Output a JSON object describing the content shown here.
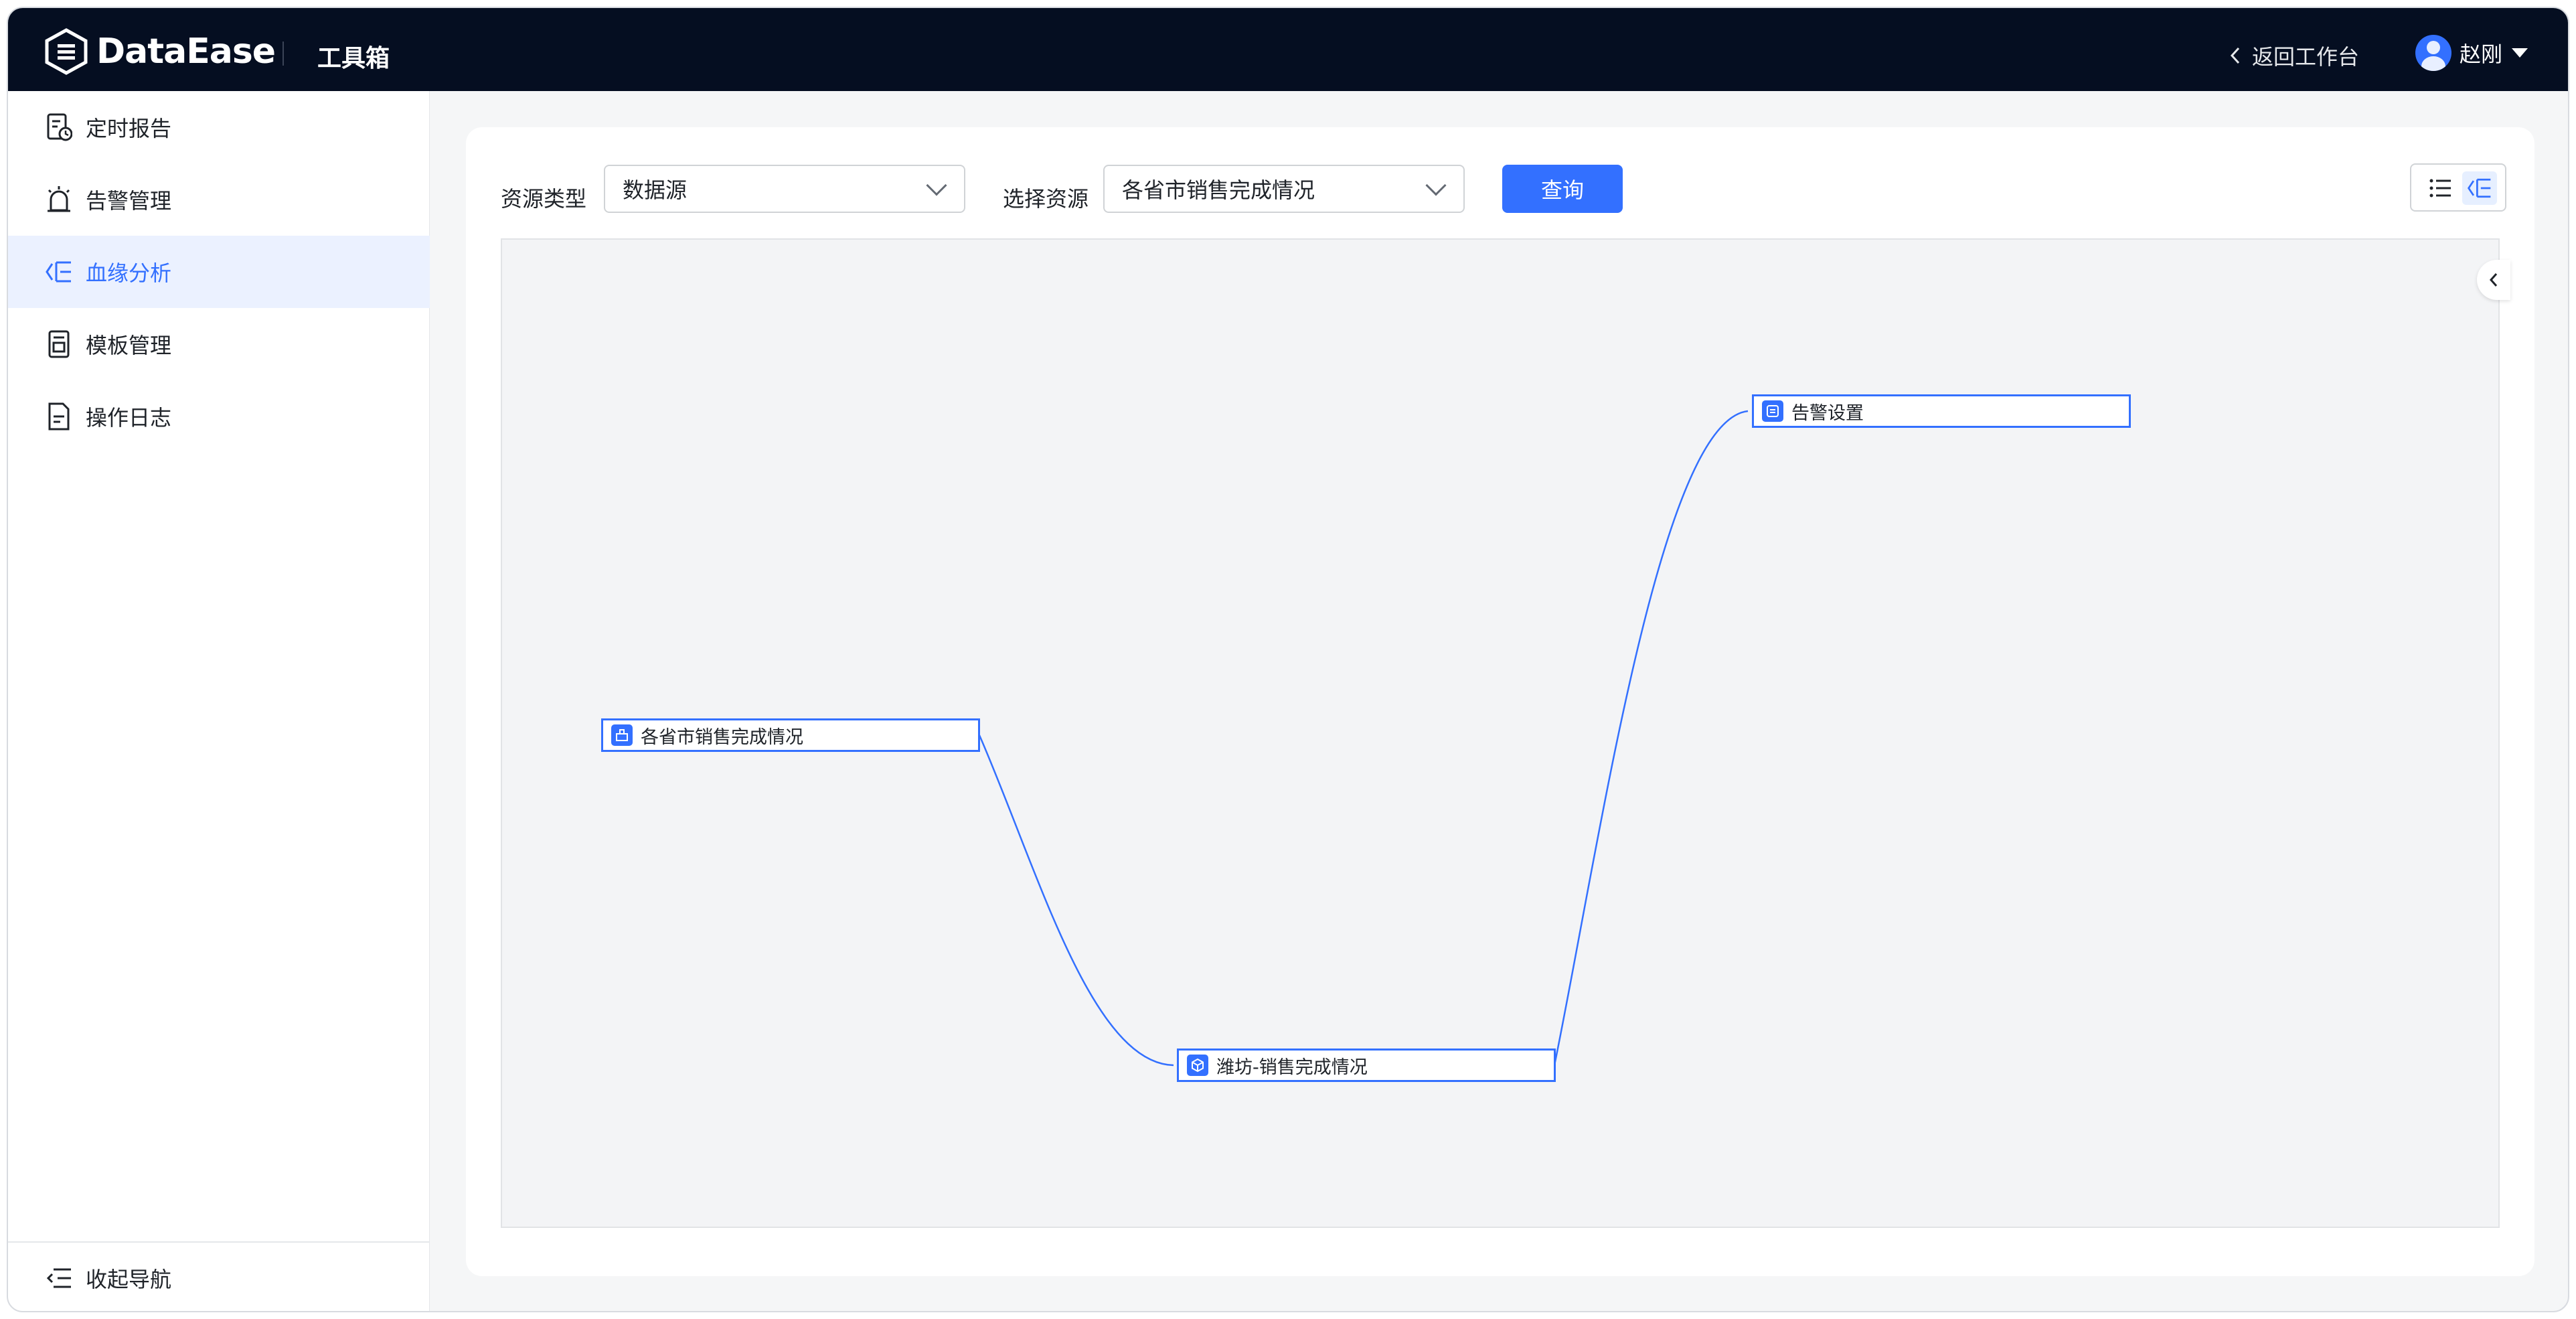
{
  "header": {
    "brand": "DataEase",
    "section_title": "工具箱",
    "back_label": "返回工作台",
    "user_name": "赵刚"
  },
  "sidebar": {
    "items": [
      {
        "label": "定时报告",
        "icon": "scheduled-report-icon"
      },
      {
        "label": "告警管理",
        "icon": "alarm-icon"
      },
      {
        "label": "血缘分析",
        "icon": "lineage-icon",
        "active": true
      },
      {
        "label": "模板管理",
        "icon": "template-icon"
      },
      {
        "label": "操作日志",
        "icon": "log-icon"
      }
    ],
    "collapse_label": "收起导航"
  },
  "filters": {
    "resource_type_label": "资源类型",
    "resource_type_value": "数据源",
    "resource_label": "选择资源",
    "resource_value": "各省市销售完成情况",
    "query_label": "查询"
  },
  "graph": {
    "nodes": [
      {
        "label": "各省市销售完成情况",
        "kind": "datasource-icon"
      },
      {
        "label": "潍坊-销售完成情况",
        "kind": "dataset-icon"
      },
      {
        "label": "告警设置",
        "kind": "alarm-setting-icon"
      }
    ]
  },
  "colors": {
    "accent": "#3370ff",
    "header_bg": "#050e21",
    "canvas_bg": "#f3f4f6"
  }
}
